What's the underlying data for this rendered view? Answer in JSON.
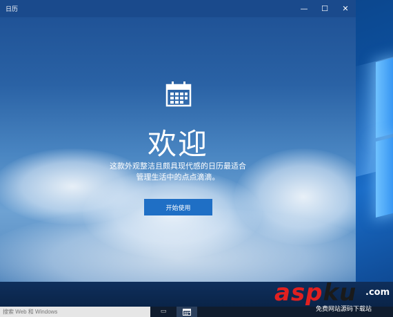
{
  "window": {
    "title": "日历",
    "minimize_label": "—",
    "maximize_label": "☐",
    "close_label": "✕"
  },
  "welcome": {
    "icon": "calendar-icon",
    "title": "欢迎",
    "description_line1": "这款外观整洁且颇具现代感的日历最适合",
    "description_line2": "管理生活中的点点滴滴。",
    "start_button": "开始使用"
  },
  "taskbar": {
    "search_placeholder": "搜索 Web 和 Windows",
    "task_view_icon": "task-view-icon",
    "calendar_app_icon": "calendar-icon"
  },
  "watermark": {
    "brand_red": "asp",
    "brand_dark": "ku",
    "domain": ".com",
    "subtitle": "免费网站源码下载站"
  },
  "colors": {
    "accent": "#1f6fc5",
    "titlebar": "#1a4a8c",
    "watermark_red": "#e02020"
  }
}
